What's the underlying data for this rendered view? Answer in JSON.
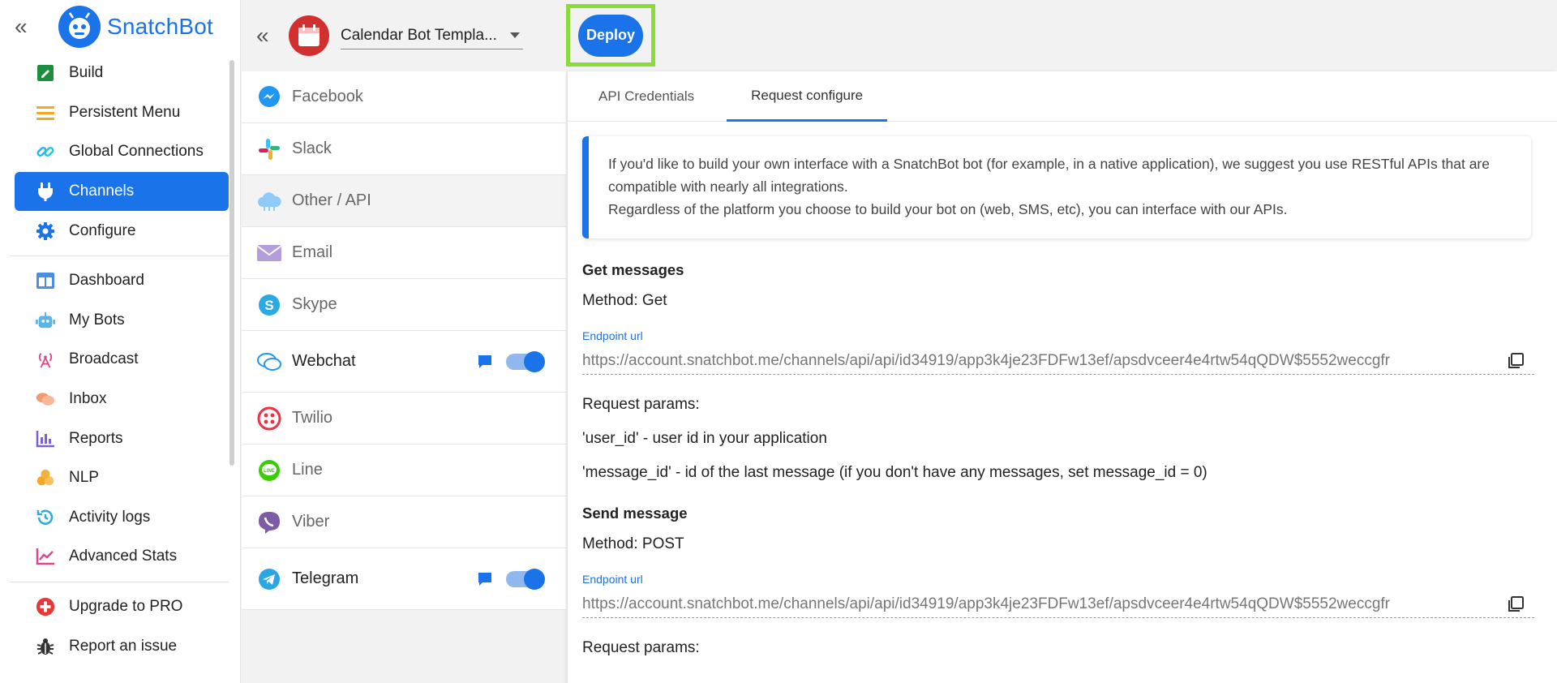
{
  "brand": {
    "name": "SnatchBot",
    "collapse_glyph": "«",
    "color": "#1a73e8"
  },
  "sidebar": {
    "groups": [
      [
        {
          "label": "Build",
          "icon": "build-icon"
        },
        {
          "label": "Persistent Menu",
          "icon": "menu-icon"
        },
        {
          "label": "Global Connections",
          "icon": "link-icon"
        },
        {
          "label": "Channels",
          "icon": "plug-icon",
          "active": true
        },
        {
          "label": "Configure",
          "icon": "gear-icon"
        }
      ],
      [
        {
          "label": "Dashboard",
          "icon": "dashboard-icon"
        },
        {
          "label": "My Bots",
          "icon": "robot-icon"
        },
        {
          "label": "Broadcast",
          "icon": "broadcast-icon"
        },
        {
          "label": "Inbox",
          "icon": "chat-bubbles-icon"
        },
        {
          "label": "Reports",
          "icon": "reports-icon"
        },
        {
          "label": "NLP",
          "icon": "nlp-icon"
        },
        {
          "label": "Activity logs",
          "icon": "history-icon"
        },
        {
          "label": "Advanced Stats",
          "icon": "stats-icon"
        }
      ],
      [
        {
          "label": "Upgrade to PRO",
          "icon": "plus-badge-icon"
        },
        {
          "label": "Report an issue",
          "icon": "bug-icon"
        }
      ]
    ]
  },
  "channels_panel": {
    "collapse_glyph": "«",
    "bot_name": "Calendar Bot Templa...",
    "items": [
      {
        "label": "Facebook",
        "icon": "messenger-icon"
      },
      {
        "label": "Slack",
        "icon": "slack-icon"
      },
      {
        "label": "Other / API",
        "icon": "cloud-icon",
        "active": true
      },
      {
        "label": "Email",
        "icon": "email-icon"
      },
      {
        "label": "Skype",
        "icon": "skype-icon"
      },
      {
        "label": "Webchat",
        "icon": "webchat-icon",
        "enabled": true
      },
      {
        "label": "Twilio",
        "icon": "twilio-icon"
      },
      {
        "label": "Line",
        "icon": "line-icon"
      },
      {
        "label": "Viber",
        "icon": "viber-icon"
      },
      {
        "label": "Telegram",
        "icon": "telegram-icon",
        "enabled": true
      }
    ]
  },
  "topbar": {
    "deploy_label": "Deploy"
  },
  "tabs": [
    {
      "label": "API Credentials"
    },
    {
      "label": "Request configure",
      "active": true
    }
  ],
  "info": {
    "line1": "If you'd like to build your own interface with a SnatchBot bot (for example, in a native application), we suggest you use RESTful APIs that are compatible with nearly all integrations.",
    "line2": "Regardless of the platform you choose to build your bot on (web, SMS, etc), you can interface with our APIs."
  },
  "get_messages": {
    "heading": "Get messages",
    "method": "Method: Get",
    "endpoint_label": "Endpoint url",
    "endpoint_url": "https://account.snatchbot.me/channels/api/api/id34919/app3k4je23FDFw13ef/apsdvceer4e4rtw54qQDW$5552weccgfr",
    "params_heading": "Request params:",
    "param_user": "'user_id' - user id in your application",
    "param_message": "'message_id' - id of the last message (if you don't have any messages, set message_id = 0)"
  },
  "send_message": {
    "heading": "Send message",
    "method": "Method: POST",
    "endpoint_label": "Endpoint url",
    "endpoint_url": "https://account.snatchbot.me/channels/api/api/id34919/app3k4je23FDFw13ef/apsdvceer4e4rtw54qQDW$5552weccgfr",
    "params_heading": "Request params:"
  }
}
